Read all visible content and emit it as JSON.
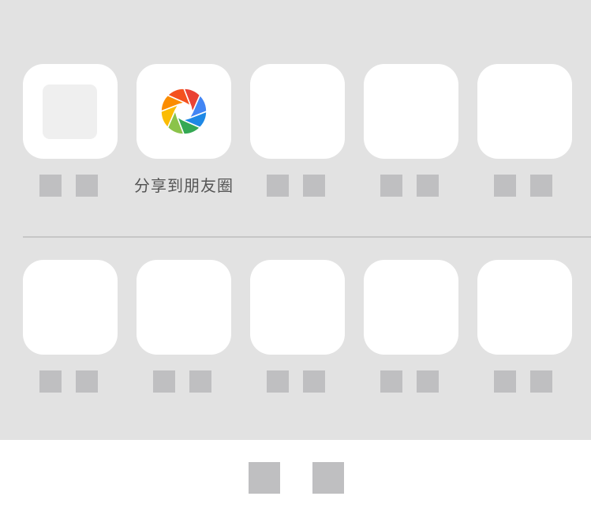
{
  "share_row": {
    "items": [
      {
        "label": ""
      },
      {
        "label": "分享到朋友圈",
        "icon": "moments-aperture-icon"
      },
      {
        "label": ""
      },
      {
        "label": ""
      },
      {
        "label": ""
      }
    ]
  },
  "action_row": {
    "items": [
      {
        "label": ""
      },
      {
        "label": ""
      },
      {
        "label": ""
      },
      {
        "label": ""
      },
      {
        "label": ""
      }
    ]
  },
  "cancel": {
    "label": ""
  },
  "colors": {
    "sheet_background": "#e2e2e2",
    "tile": "#ffffff",
    "placeholder_block": "#bfbfc1",
    "label_text": "#555555",
    "aperture": [
      "#e94235",
      "#4285f4",
      "#1e88e5",
      "#34a853",
      "#8bc34a",
      "#fbbc04",
      "#fb8c00",
      "#f4511e"
    ]
  }
}
